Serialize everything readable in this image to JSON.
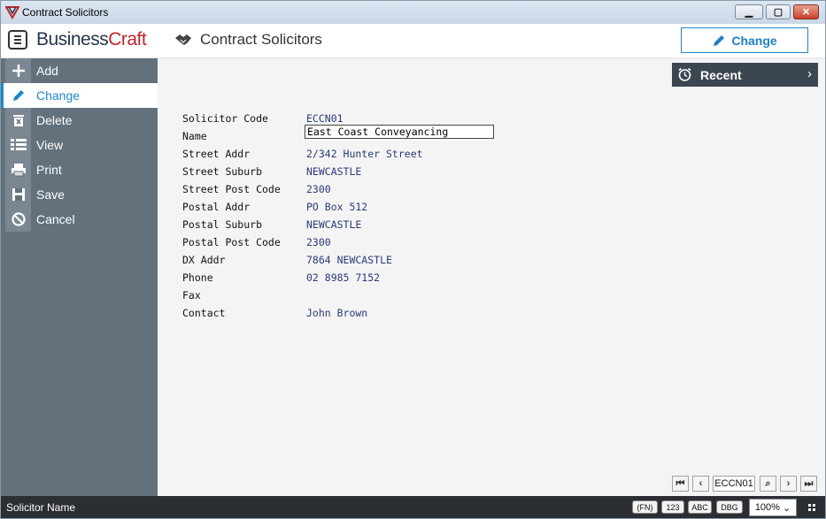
{
  "window": {
    "title": "Contract Solicitors",
    "minimize_glyph": "▁",
    "maximize_glyph": "▢",
    "close_glyph": "✕"
  },
  "header": {
    "logo_main": "Business",
    "logo_accent": "Craft",
    "screen_title": "Contract Solicitors",
    "change_label": "Change"
  },
  "sidebar": {
    "items": [
      {
        "label": "Add",
        "icon": "plus-icon"
      },
      {
        "label": "Change",
        "icon": "pencil-icon"
      },
      {
        "label": "Delete",
        "icon": "trash-icon"
      },
      {
        "label": "View",
        "icon": "list-icon"
      },
      {
        "label": "Print",
        "icon": "printer-icon"
      },
      {
        "label": "Save",
        "icon": "floppy-icon"
      },
      {
        "label": "Cancel",
        "icon": "cancel-icon"
      }
    ]
  },
  "recent": {
    "label": "Recent",
    "chevron": "›"
  },
  "form": {
    "fields": [
      {
        "label": "Solicitor Code",
        "value": "ECCN01"
      },
      {
        "label": "Name",
        "value": "East Coast Conveyancing"
      },
      {
        "label": "Street Addr",
        "value": "2/342 Hunter Street"
      },
      {
        "label": "Street Suburb",
        "value": "NEWCASTLE"
      },
      {
        "label": "Street Post Code",
        "value": "2300"
      },
      {
        "label": "Postal Addr",
        "value": "PO Box 512"
      },
      {
        "label": "Postal Suburb",
        "value": "NEWCASTLE"
      },
      {
        "label": "Postal Post Code",
        "value": "2300"
      },
      {
        "label": "DX Addr",
        "value": "7864 NEWCASTLE"
      },
      {
        "label": "Phone",
        "value": "02 8985 7152"
      },
      {
        "label": "Fax",
        "value": ""
      },
      {
        "label": "Contact",
        "value": "John Brown"
      }
    ]
  },
  "navigator": {
    "first": "⏮",
    "prev": "‹",
    "code": "ECCN01",
    "search": "⌕",
    "next": "›",
    "last": "⏭"
  },
  "status": {
    "field_name": "Solicitor Name",
    "fn_label": "(FN)",
    "num_label": "123",
    "abc_label": "ABC",
    "dbg_label": "DBG",
    "zoom": "100%",
    "zoom_caret": "⌄"
  },
  "colors": {
    "accent": "#1e88c8",
    "sidebar": "#63717c",
    "statusbar": "#2b2f34",
    "value_text": "#2c3a78",
    "logo_red": "#c0262d"
  }
}
